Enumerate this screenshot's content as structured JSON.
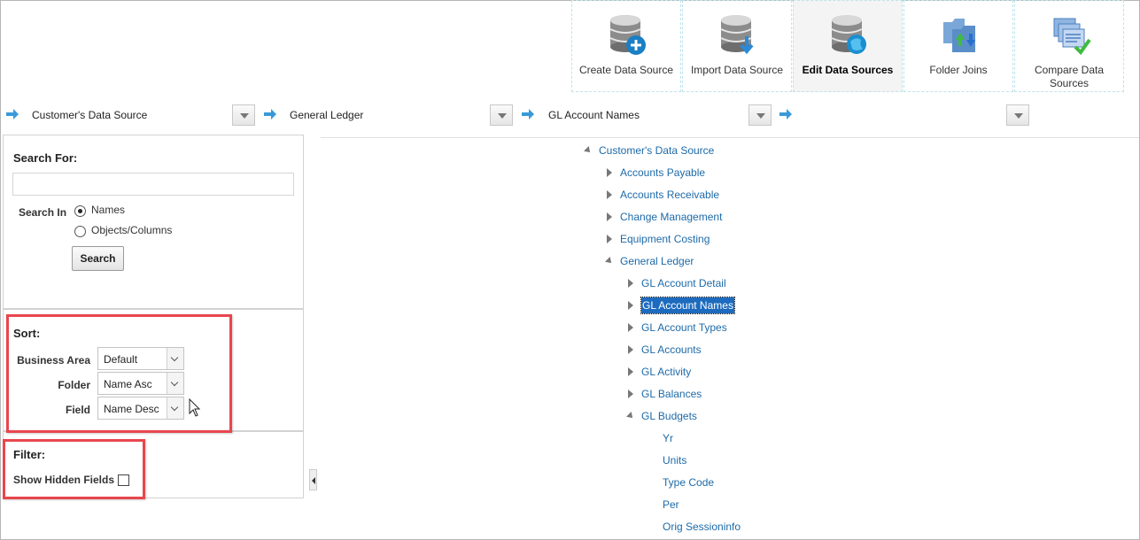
{
  "toolbar": {
    "items": [
      {
        "label": "Create Data Source",
        "icon": "create-data-source-icon",
        "active": false
      },
      {
        "label": "Import Data Source",
        "icon": "import-data-source-icon",
        "active": false
      },
      {
        "label": "Edit Data Sources",
        "icon": "edit-data-sources-icon",
        "active": true
      },
      {
        "label": "Folder Joins",
        "icon": "folder-joins-icon",
        "active": false
      },
      {
        "label": "Compare Data Sources",
        "icon": "compare-data-sources-icon",
        "active": false
      }
    ]
  },
  "breadcrumb": {
    "combos": [
      {
        "value": "Customer's Data Source"
      },
      {
        "value": "General Ledger"
      },
      {
        "value": "GL Account Names"
      },
      {
        "value": ""
      }
    ]
  },
  "search": {
    "heading": "Search For:",
    "input_value": "",
    "search_in_label": "Search In",
    "options": [
      "Names",
      "Objects/Columns"
    ],
    "selected": "Names",
    "button_label": "Search"
  },
  "sort": {
    "heading": "Sort:",
    "rows": [
      {
        "label": "Business Area",
        "value": "Default"
      },
      {
        "label": "Folder",
        "value": "Name Asc"
      },
      {
        "label": "Field",
        "value": "Name Desc"
      }
    ]
  },
  "filter": {
    "heading": "Filter:",
    "show_hidden_label": "Show Hidden Fields",
    "show_hidden_checked": false
  },
  "tree": {
    "items": [
      {
        "label": "Customer's Data Source",
        "level": 0,
        "state": "open"
      },
      {
        "label": "Accounts Payable",
        "level": 1,
        "state": "closed"
      },
      {
        "label": "Accounts Receivable",
        "level": 1,
        "state": "closed"
      },
      {
        "label": "Change Management",
        "level": 1,
        "state": "closed"
      },
      {
        "label": "Equipment Costing",
        "level": 1,
        "state": "closed"
      },
      {
        "label": "General Ledger",
        "level": 1,
        "state": "open"
      },
      {
        "label": "GL Account Detail",
        "level": 2,
        "state": "closed"
      },
      {
        "label": "GL Account Names",
        "level": 2,
        "state": "closed",
        "selected": true
      },
      {
        "label": "GL Account Types",
        "level": 2,
        "state": "closed"
      },
      {
        "label": "GL Accounts",
        "level": 2,
        "state": "closed"
      },
      {
        "label": "GL Activity",
        "level": 2,
        "state": "closed"
      },
      {
        "label": "GL Balances",
        "level": 2,
        "state": "closed"
      },
      {
        "label": "GL Budgets",
        "level": 2,
        "state": "open"
      },
      {
        "label": "Yr",
        "level": 3,
        "state": "leaf"
      },
      {
        "label": "Units",
        "level": 3,
        "state": "leaf"
      },
      {
        "label": "Type Code",
        "level": 3,
        "state": "leaf"
      },
      {
        "label": "Per",
        "level": 3,
        "state": "leaf"
      },
      {
        "label": "Orig Sessioninfo",
        "level": 3,
        "state": "leaf"
      }
    ]
  },
  "colors": {
    "link": "#1d6aa8",
    "selection": "#1c6bbf",
    "highlight_box": "#e8464e",
    "arrow": "#3a9ad9"
  }
}
